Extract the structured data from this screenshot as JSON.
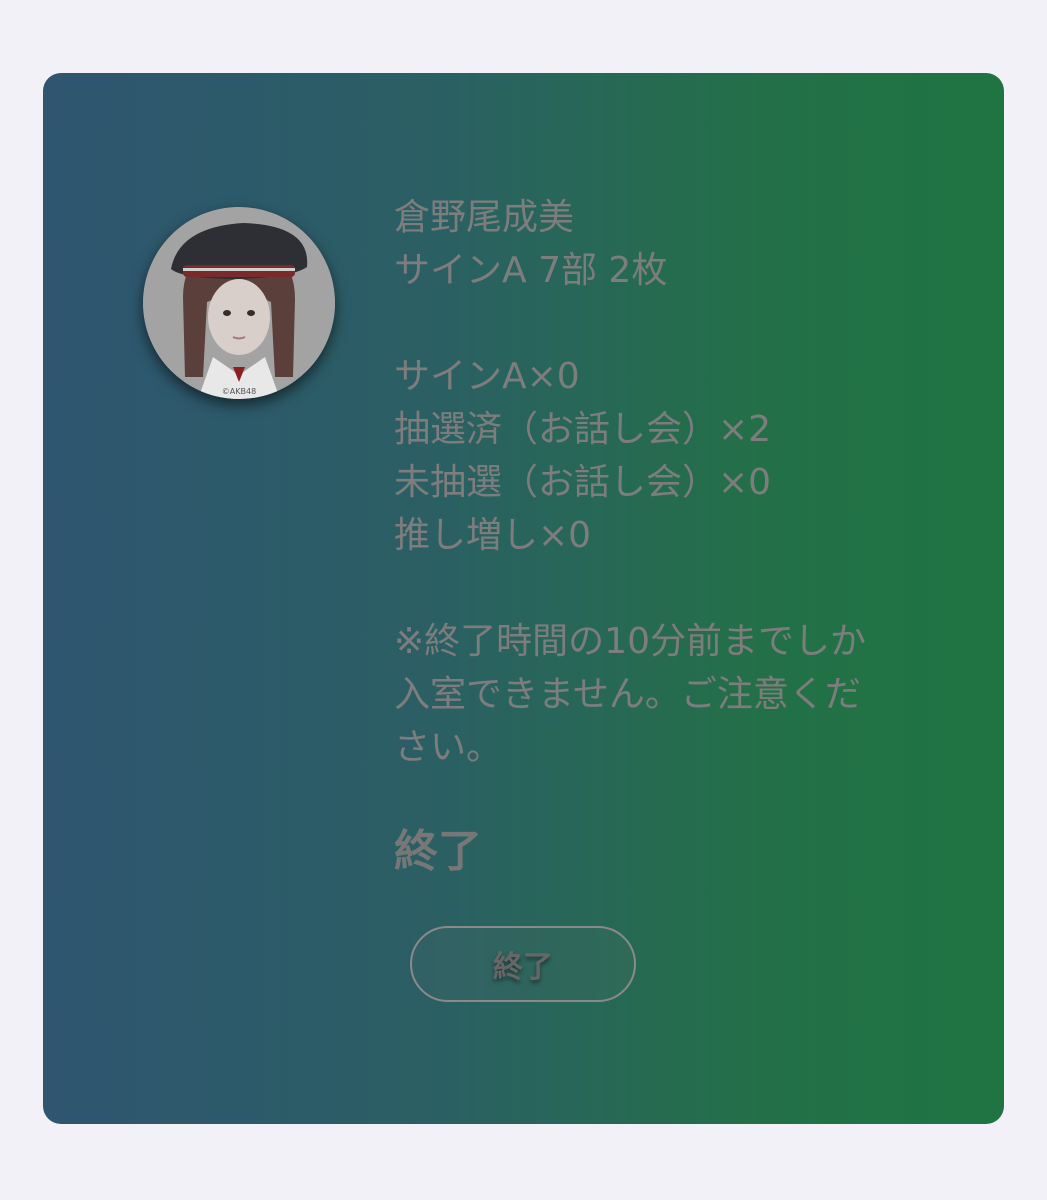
{
  "member": {
    "name": "倉野尾成美",
    "session": "サインA 7部 2枚",
    "photo_credit": "©AKB48"
  },
  "tickets": [
    "サインA×0",
    "抽選済（お話し会）×2",
    "未抽選（お話し会）×0",
    "推し増し×0"
  ],
  "notice": "※終了時間の10分前までしか入室できません。ご注意ください。",
  "status": "終了",
  "button": {
    "label": "終了"
  },
  "colors": {
    "page_background": "#f1f1f7",
    "card_gradient_start": "#2f5570",
    "card_gradient_end": "#1f7442",
    "text": "#7d7d7d"
  }
}
